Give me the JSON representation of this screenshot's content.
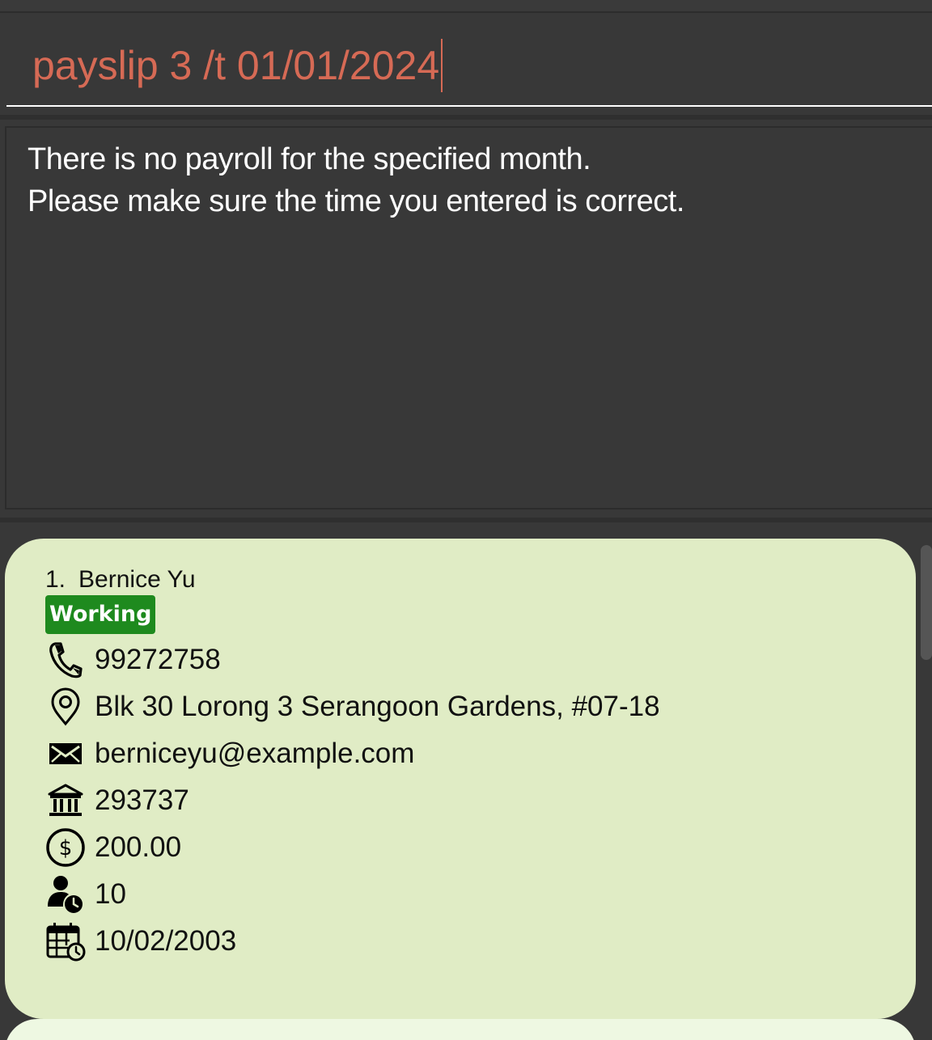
{
  "command": {
    "input_value": "payslip 3 /t 01/01/2024"
  },
  "result": {
    "lines": [
      "There is no payroll for the specified month.",
      "Please make sure the time you entered is correct."
    ]
  },
  "employee_list": {
    "cards": [
      {
        "index": "1.",
        "name": "Bernice Yu",
        "status_tag": "Working",
        "phone": "99272758",
        "address": "Blk 30 Lorong 3 Serangoon Gardens, #07-18",
        "email": "berniceyu@example.com",
        "bank_account": "293737",
        "salary": "200.00",
        "annual_leave": "10",
        "date": "10/02/2003"
      }
    ]
  },
  "icons": {
    "phone": "phone-icon",
    "address": "location-pin-icon",
    "email": "envelope-icon",
    "bank": "bank-icon",
    "salary": "dollar-circle-icon",
    "leave": "person-clock-icon",
    "date": "calendar-clock-icon"
  },
  "colors": {
    "background": "#383838",
    "command_text": "#d66a55",
    "result_text": "#ffffff",
    "card_background": "#e0ecc5",
    "next_card_background": "#eef8e2",
    "status_tag": "#1e8a1e"
  }
}
